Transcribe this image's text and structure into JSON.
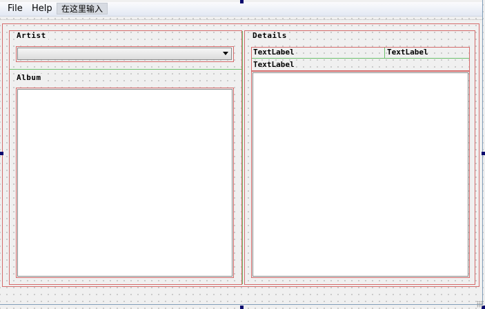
{
  "menubar": {
    "items": [
      "File",
      "Help"
    ],
    "type_here": "在这里输入"
  },
  "artist": {
    "title": "Artist",
    "combo_value": ""
  },
  "album": {
    "title": "Album"
  },
  "details": {
    "title": "Details",
    "labels": [
      "TextLabel",
      "TextLabel",
      "TextLabel"
    ]
  }
}
